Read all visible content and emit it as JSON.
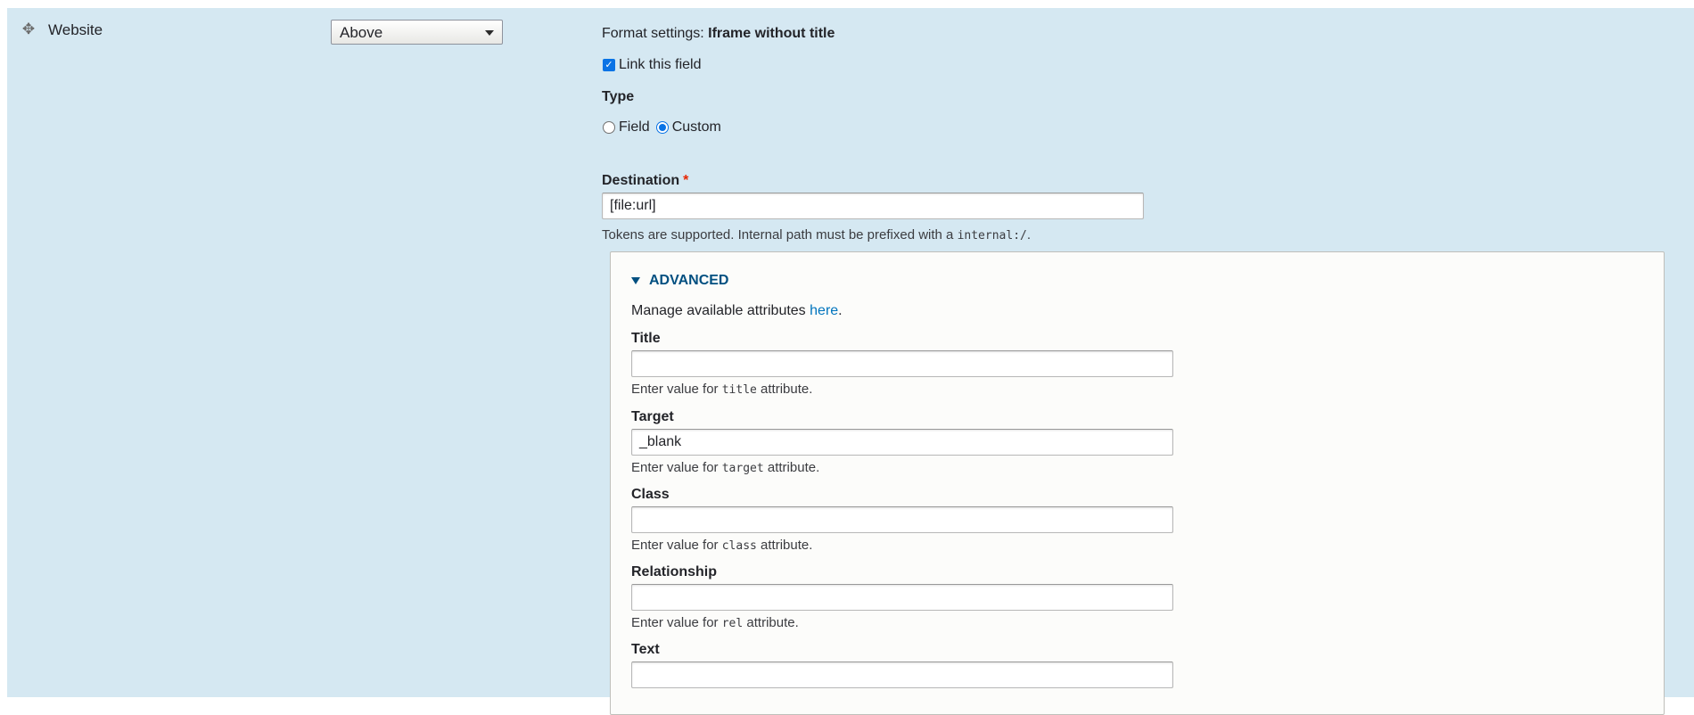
{
  "row": {
    "field_name": "Website",
    "label_display": "Above",
    "drag_icon": "drag-move-icon"
  },
  "settings": {
    "format_prefix": "Format settings:",
    "format_name": "Iframe without title",
    "link_checkbox_label": "Link this field",
    "link_checked": true,
    "type_label": "Type",
    "type_options": [
      "Field",
      "Custom"
    ],
    "type_selected": "Custom",
    "destination_label": "Destination",
    "required_marker": "*",
    "destination_value": "[file:url]",
    "destination_desc_prefix": "Tokens are supported. Internal path must be prefixed with a",
    "destination_desc_code": "internal:/",
    "destination_desc_suffix": "."
  },
  "advanced": {
    "summary": "ADVANCED",
    "manage_prefix": "Manage available attributes",
    "manage_link": "here",
    "manage_suffix": ".",
    "desc_prefix": "Enter value for",
    "desc_suffix": "attribute.",
    "fields": [
      {
        "label": "Title",
        "value": "",
        "attr": "title"
      },
      {
        "label": "Target",
        "value": "_blank",
        "attr": "target"
      },
      {
        "label": "Class",
        "value": "",
        "attr": "class"
      },
      {
        "label": "Relationship",
        "value": "",
        "attr": "rel"
      },
      {
        "label": "Text",
        "value": "",
        "attr": ""
      }
    ]
  },
  "colors": {
    "row_background": "#d5e8f2",
    "link": "#0074bd",
    "advanced_summary": "#004f80",
    "required": "#e62600",
    "checkbox_accent": "#0a73e5"
  }
}
